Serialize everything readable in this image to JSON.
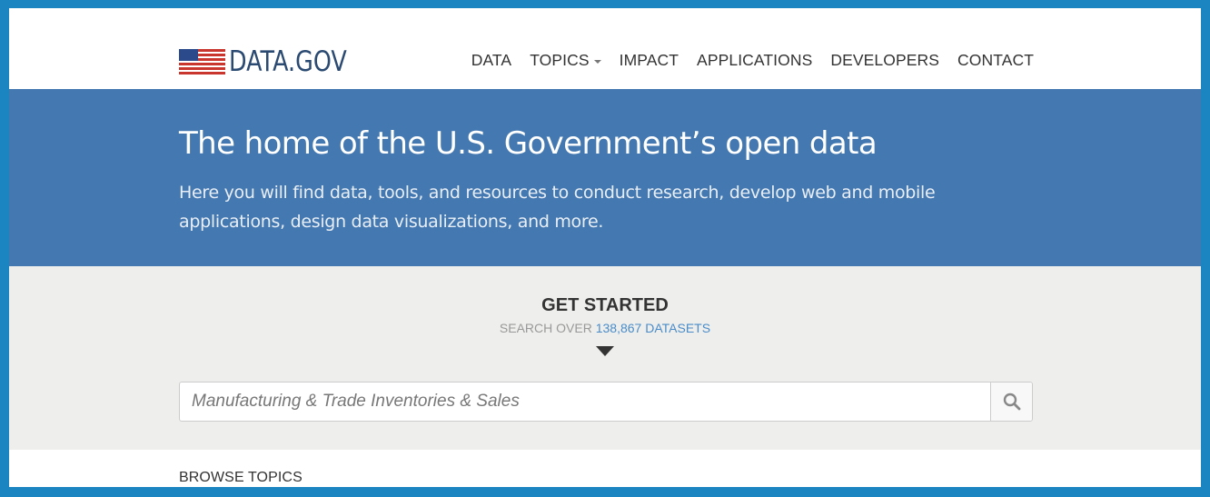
{
  "brand": {
    "logo_text": "DATA.GOV",
    "icon": "us-flag-icon"
  },
  "nav": {
    "items": [
      {
        "label": "DATA",
        "has_caret": false
      },
      {
        "label": "TOPICS",
        "has_caret": true
      },
      {
        "label": "IMPACT",
        "has_caret": false
      },
      {
        "label": "APPLICATIONS",
        "has_caret": false
      },
      {
        "label": "DEVELOPERS",
        "has_caret": false
      },
      {
        "label": "CONTACT",
        "has_caret": false
      }
    ]
  },
  "hero": {
    "title": "The home of the U.S. Government’s open data",
    "description": "Here you will find data, tools, and resources to conduct research, develop web and mobile applications, design data visualizations, and more."
  },
  "get_started": {
    "title": "GET STARTED",
    "subtitle_prefix": "SEARCH OVER ",
    "dataset_count_link": "138,867 DATASETS",
    "arrow_icon": "triangle-down-icon"
  },
  "search": {
    "placeholder": "Manufacturing & Trade Inventories & Sales",
    "value": "",
    "button_icon": "search-icon"
  },
  "browse": {
    "title": "BROWSE TOPICS"
  },
  "colors": {
    "frame_border": "#1a85c0",
    "hero_background": "#4478b0",
    "get_started_background": "#eeeeec",
    "link_blue": "#4a8cc9",
    "logo_text": "#2b4a72"
  }
}
